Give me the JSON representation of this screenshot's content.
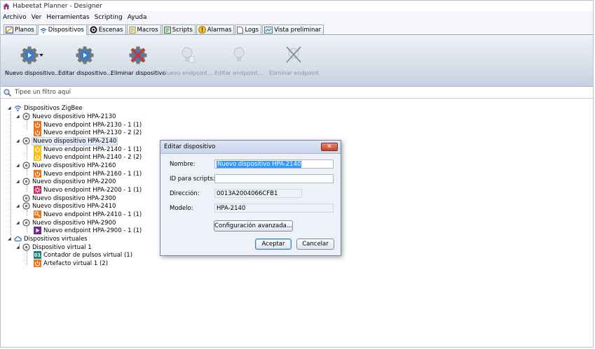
{
  "window": {
    "title": "Habeetat Planner - Designer"
  },
  "menu": [
    "Archivo",
    "Ver",
    "Herramientas",
    "Scripting",
    "Ayuda"
  ],
  "tabs": [
    {
      "label": "Planos",
      "icon": "floorplan-icon",
      "active": false
    },
    {
      "label": "Dispositivos",
      "icon": "wireless-icon",
      "active": true
    },
    {
      "label": "Escenas",
      "icon": "scenes-icon",
      "active": false
    },
    {
      "label": "Macros",
      "icon": "macro-icon",
      "active": false
    },
    {
      "label": "Scripts",
      "icon": "script-icon",
      "active": false
    },
    {
      "label": "Alarmas",
      "icon": "alarm-icon",
      "active": false
    },
    {
      "label": "Logs",
      "icon": "log-icon",
      "active": false
    },
    {
      "label": "Vista preliminar",
      "icon": "preview-icon",
      "active": false
    }
  ],
  "toolbar": {
    "new_device": "Nuevo dispositivo...",
    "edit_device": "Editar dispositivo...",
    "delete_device": "Eliminar dispositivo",
    "new_endpoint": "Nuevo endpoint...",
    "edit_endpoint": "Editar endpoint...",
    "delete_endpoint": "Eliminar endpoint"
  },
  "filter": {
    "placeholder": "Tipee un filtro aquí"
  },
  "tree": {
    "zigbee_root": "Dispositivos ZigBee",
    "virtual_root": "Dispositivos virtuales",
    "devices": [
      {
        "label": "Nuevo dispositivo HPA-2130",
        "endpoints": [
          "Nuevo endpoint HPA-2130 - 1 (1)",
          "Nuevo endpoint HPA-2130 - 2 (2)"
        ]
      },
      {
        "label": "Nuevo dispositivo HPA-2140",
        "endpoints": [
          "Nuevo endpoint HPA-2140 - 1 (1)",
          "Nuevo endpoint HPA-2140 - 2 (2)"
        ]
      },
      {
        "label": "Nuevo dispositivo HPA-2160",
        "endpoints": [
          "Nuevo endpoint HPA-2160 - 1 (1)"
        ]
      },
      {
        "label": "Nuevo dispositivo HPA-2200",
        "endpoints": [
          "Nuevo endpoint HPA-2200 - 1 (1)"
        ]
      },
      {
        "label": "Nuevo dispositivo HPA-2300",
        "endpoints": []
      },
      {
        "label": "Nuevo dispositivo HPA-2410",
        "endpoints": [
          "Nuevo endpoint HPA-2410 - 1 (1)"
        ]
      },
      {
        "label": "Nuevo dispositivo HPA-2900",
        "endpoints": [
          "Nuevo endpoint HPA-2900 - 1 (1)"
        ]
      }
    ],
    "virtual_device": "Dispositivo virtual 1",
    "virtual_endpoints": [
      "Contador de pulsos virtual (1)",
      "Artefacto virtual 1 (2)"
    ],
    "counter_icon_text": "01"
  },
  "dialog": {
    "title": "Editar dispositivo",
    "close_glyph": "✕",
    "name_label": "Nombre:",
    "name_value": "Nuevo dispositivo HPA-2140",
    "script_id_label": "ID para scripts:",
    "script_id_value": "",
    "address_label": "Dirección:",
    "address_value": "0013A2004066CFB1",
    "model_label": "Modelo:",
    "model_value": "HPA-2140",
    "advanced_button": "Configuración avanzada...",
    "accept_button": "Aceptar",
    "cancel_button": "Cancelar"
  },
  "colors": {
    "power_orange": "#e8761c",
    "power_yellow": "#f2c21a",
    "pink": "#d4235c",
    "purple": "#6b2d8f",
    "teal": "#1d7f7a",
    "selection_blue": "#3399ff"
  }
}
